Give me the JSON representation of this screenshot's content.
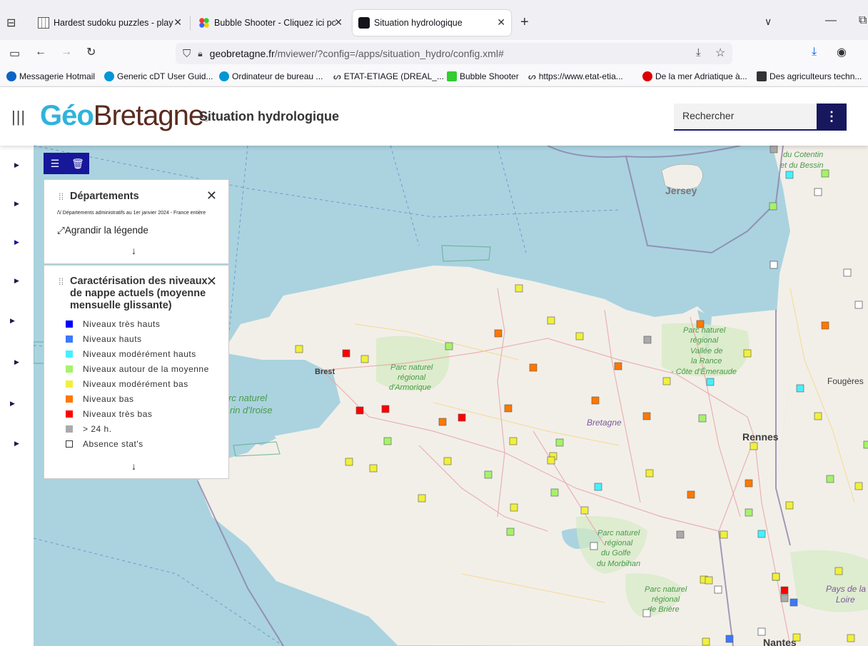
{
  "browser": {
    "tabs": [
      {
        "title": "Hardest sudoku puzzles - play s",
        "active": false
      },
      {
        "title": "Bubble Shooter - Cliquez ici po",
        "active": false
      },
      {
        "title": "Situation hydrologique",
        "active": true
      }
    ],
    "new_tab": "+",
    "url_host": "geobretagne.fr",
    "url_path": "/mviewer/?config=/apps/situation_hydro/config.xml#",
    "bookmarks": [
      "Messagerie Hotmail",
      "Generic cDT User Guid...",
      "Ordinateur de bureau ...",
      "ETAT-ETIAGE (DREAL_...",
      "Bubble Shooter",
      "https://www.etat-etia...",
      "De la mer Adriatique à...",
      "Des agriculteurs techn..."
    ]
  },
  "app": {
    "logo_geo": "Géo",
    "logo_bretagne": "Bretagne",
    "logo_reg": "®",
    "title": "Situation hydrologique",
    "search_placeholder": "Rechercher",
    "menu_glyph": "⋮"
  },
  "legend_departements": {
    "title": "Départements",
    "subtitle": "Départements administratifs au 1er janvier 2024 - France entière",
    "expand": "Agrandir la légende"
  },
  "legend_nappes": {
    "title_lines": [
      "Caractérisation des niveaux",
      "de nappe actuels (moyenne",
      "mensuelle glissante)"
    ],
    "items": [
      {
        "label": "Niveaux très hauts",
        "color": "#0000ff"
      },
      {
        "label": "Niveaux hauts",
        "color": "#3c78ff"
      },
      {
        "label": "Niveaux modérément hauts",
        "color": "#46f0ff"
      },
      {
        "label": "Niveaux autour de la moyenne",
        "color": "#a6f26a"
      },
      {
        "label": "Niveaux modérément bas",
        "color": "#f0f03c"
      },
      {
        "label": "Niveaux bas",
        "color": "#ff7800"
      },
      {
        "label": "Niveaux très bas",
        "color": "#ff0000"
      },
      {
        "label": "> 24 h.",
        "color": "#aaaaaa"
      },
      {
        "label": "Absence stat's",
        "color": "#ffffff"
      }
    ]
  },
  "map_labels": [
    "du Cotentin",
    "et du Bessin",
    "Jersey",
    "Brest",
    "Parc naturel",
    "régional",
    "d'Armorique",
    "rc naturel",
    "rin d'Iroise",
    "Bretagne",
    "Rennes",
    "Fougères",
    "Vallée de",
    "la Rance",
    "- Côte d'Émeraude",
    "du Golfe",
    "du Morbihan",
    "de Brière",
    "Pays de la",
    "Loire",
    "Nantes"
  ]
}
